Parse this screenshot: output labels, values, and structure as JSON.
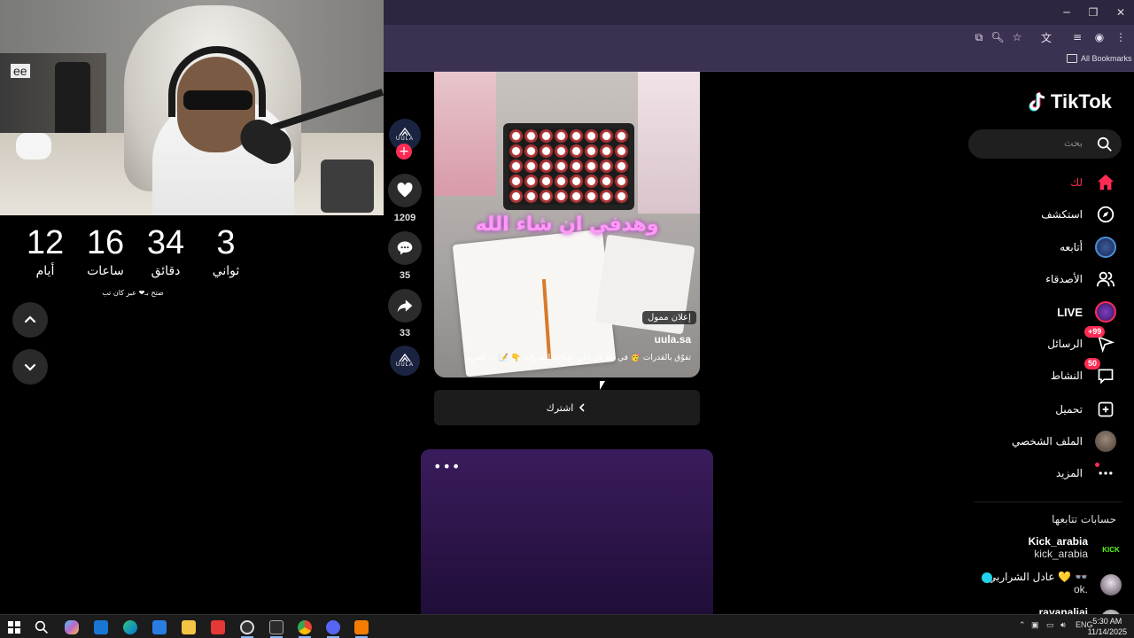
{
  "browser": {
    "bookmarks_label": "All Bookmarks"
  },
  "countdown": {
    "units": [
      {
        "value": "12",
        "label": "أيام"
      },
      {
        "value": "16",
        "label": "ساعات"
      },
      {
        "value": "34",
        "label": "دقائق"
      },
      {
        "value": "3",
        "label": "ثواني"
      }
    ],
    "footer": "ضتح بـ❤ عبر كان تب"
  },
  "video": {
    "overlay_caption": "وهدفي ان شاء الله",
    "ad_badge": "إعلان ممول",
    "username": "uula.sa",
    "description": "تفوّق بالقدرات 🥳 في علا كل اللي تحتاجه للقدرات 👇 📝 ... المزيد",
    "subscribe_label": "اشترك",
    "next_menu": "•••"
  },
  "actions": {
    "likes": "1209",
    "comments": "35",
    "shares": "33",
    "account_logo": "UULA"
  },
  "sidebar": {
    "logo_text": "TikTok",
    "search_placeholder": "بحث",
    "nav": [
      {
        "label": "لك",
        "icon": "home-icon",
        "active": true
      },
      {
        "label": "استكشف",
        "icon": "compass-icon"
      },
      {
        "label": "أتابعه",
        "icon": "following-avatar"
      },
      {
        "label": "الأصدقاء",
        "icon": "friends-icon"
      },
      {
        "label": "LIVE",
        "icon": "live-icon"
      },
      {
        "label": "الرسائل",
        "icon": "messages-icon",
        "badge": "+99"
      },
      {
        "label": "النشاط",
        "icon": "activity-icon",
        "badge": "50"
      },
      {
        "label": "تحميل",
        "icon": "upload-icon"
      },
      {
        "label": "الملف الشخصي",
        "icon": "profile-avatar"
      },
      {
        "label": "المزيد",
        "icon": "more-icon"
      }
    ],
    "following_title": "حسابات تتابعها",
    "accounts": [
      {
        "name": "Kick_arabia",
        "handle": "kick_arabia",
        "avatar_text": "KICK"
      },
      {
        "name": "عادل الشراربي 💛 👓",
        "handle": "ok."
      },
      {
        "name": "rayanaliai",
        "handle": ""
      }
    ]
  },
  "taskbar": {
    "lang": "ENG",
    "time": "5:30 AM",
    "date": "11/14/2025"
  },
  "colors": {
    "accent": "#fe2c55",
    "window_chrome": "#3b3150",
    "kick_green": "#53fc18"
  }
}
